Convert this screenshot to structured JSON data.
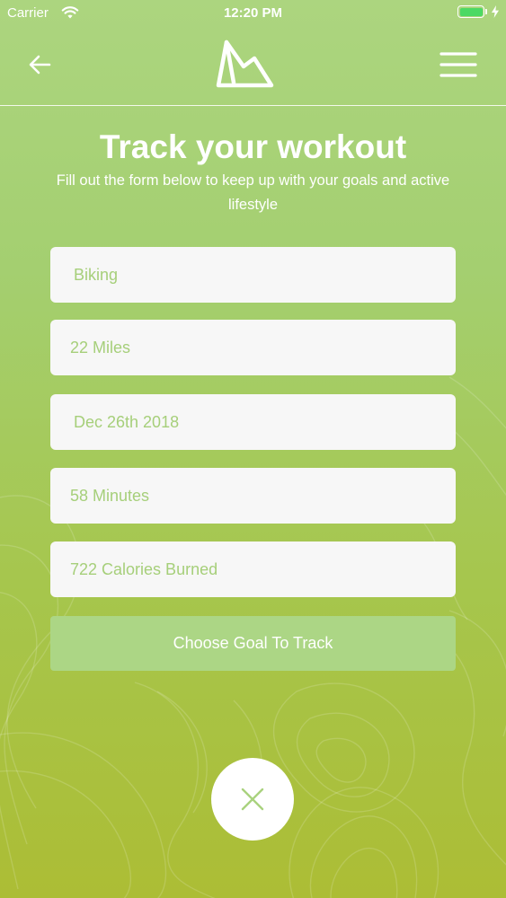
{
  "status_bar": {
    "carrier": "Carrier",
    "time": "12:20 PM"
  },
  "nav": {
    "back_icon": "arrow-left-icon",
    "logo_icon": "mountain-logo-icon",
    "menu_icon": "hamburger-menu-icon"
  },
  "heading": {
    "title": "Track your workout",
    "subtitle": "Fill out the form below to keep up with your goals and active lifestyle"
  },
  "form": {
    "activity": "Biking",
    "distance": "22 Miles",
    "date": "Dec 26th 2018",
    "duration": "58 Minutes",
    "calories": "722 Calories Burned",
    "goal_button_label": "Choose Goal To Track"
  },
  "close_button": {
    "icon": "close-icon"
  },
  "colors": {
    "gradient_top": "#acd57f",
    "gradient_bottom": "#acbd35",
    "field_text": "#a6cf7a",
    "goal_button": "#acd685",
    "field_background": "#f7f7f7",
    "battery": "#4cd964"
  }
}
